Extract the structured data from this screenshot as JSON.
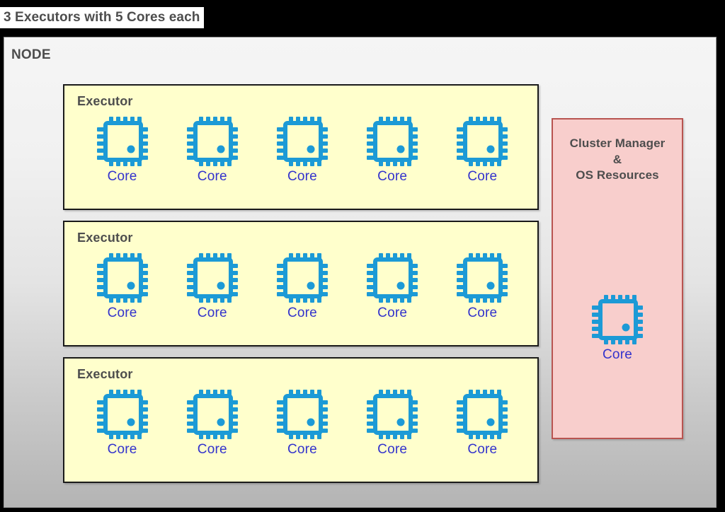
{
  "title_bar": {
    "title": "3 Executors with 5 Cores each"
  },
  "node": {
    "label": "NODE",
    "executors": [
      {
        "label": "Executor",
        "cores": [
          {
            "label": "Core",
            "icon": "cpu-chip-icon"
          },
          {
            "label": "Core",
            "icon": "cpu-chip-icon"
          },
          {
            "label": "Core",
            "icon": "cpu-chip-icon"
          },
          {
            "label": "Core",
            "icon": "cpu-chip-icon"
          },
          {
            "label": "Core",
            "icon": "cpu-chip-icon"
          }
        ]
      },
      {
        "label": "Executor",
        "cores": [
          {
            "label": "Core",
            "icon": "cpu-chip-icon"
          },
          {
            "label": "Core",
            "icon": "cpu-chip-icon"
          },
          {
            "label": "Core",
            "icon": "cpu-chip-icon"
          },
          {
            "label": "Core",
            "icon": "cpu-chip-icon"
          },
          {
            "label": "Core",
            "icon": "cpu-chip-icon"
          }
        ]
      },
      {
        "label": "Executor",
        "cores": [
          {
            "label": "Core",
            "icon": "cpu-chip-icon"
          },
          {
            "label": "Core",
            "icon": "cpu-chip-icon"
          },
          {
            "label": "Core",
            "icon": "cpu-chip-icon"
          },
          {
            "label": "Core",
            "icon": "cpu-chip-icon"
          },
          {
            "label": "Core",
            "icon": "cpu-chip-icon"
          }
        ]
      }
    ],
    "cluster_manager": {
      "line1": "Cluster Manager",
      "line2": "&",
      "line3": "OS Resources",
      "core": {
        "label": "Core",
        "icon": "cpu-chip-icon"
      }
    }
  },
  "colors": {
    "header_background": "#000000",
    "title_strip_background": "#ffffff",
    "title_text": "#4d4d4d",
    "node_panel_top": "#f5f5f5",
    "node_panel_bottom": "#b4b4b4",
    "executor_fill": "#ffffcc",
    "executor_border": "#1a1a1a",
    "cluster_fill": "#f8cecc",
    "cluster_border": "#b85450",
    "chip_blue": "#1c9ad6",
    "core_label": "#3333cc"
  }
}
